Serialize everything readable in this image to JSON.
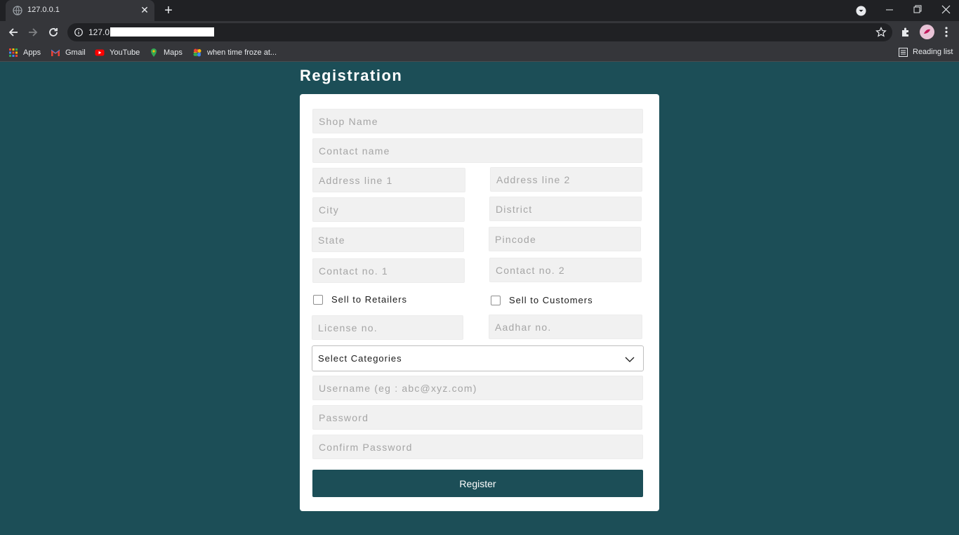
{
  "browser": {
    "tab_title": "127.0.0.1",
    "url": "127.0.",
    "bookmarks": [
      {
        "label": "Apps",
        "icon": "apps-grid-icon"
      },
      {
        "label": "Gmail",
        "icon": "gmail-icon"
      },
      {
        "label": "YouTube",
        "icon": "youtube-icon"
      },
      {
        "label": "Maps",
        "icon": "maps-pin-icon"
      },
      {
        "label": "when time froze at...",
        "icon": "pinwheel-icon"
      }
    ],
    "reading_list": "Reading list"
  },
  "page": {
    "title": "Registration",
    "fields": {
      "shop_name": "Shop Name",
      "contact_name": "Contact name",
      "address_line_1": "Address line 1",
      "address_line_2": "Address line 2",
      "city": "City",
      "district": "District",
      "state": "State",
      "pincode": "Pincode",
      "contact_no_1": "Contact no. 1",
      "contact_no_2": "Contact no. 2",
      "license_no": "License no.",
      "aadhar_no": "Aadhar no.",
      "username": "Username (eg : abc@xyz.com)",
      "password": "Password",
      "confirm_password": "Confirm Password"
    },
    "checkboxes": {
      "sell_to_retailers": "Sell to Retailers",
      "sell_to_customers": "Sell to Customers"
    },
    "select_categories": "Select Categories",
    "register_label": "Register"
  },
  "colors": {
    "background": "#1c4e57",
    "card": "#ffffff",
    "input_bg": "#f1f1f1",
    "button": "#1c4e57"
  }
}
